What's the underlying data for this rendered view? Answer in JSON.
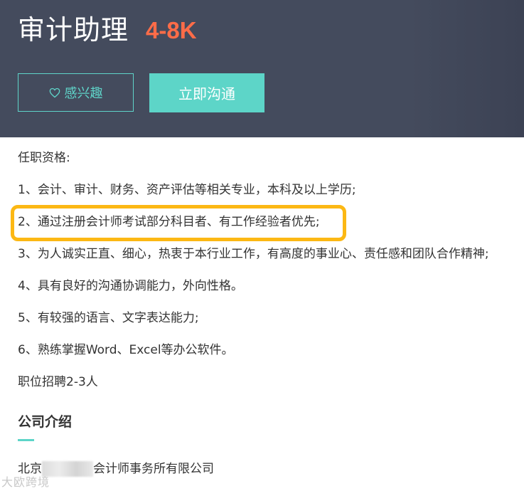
{
  "job": {
    "title": "审计助理",
    "salary": "4-8K"
  },
  "actions": {
    "interest_label": "感兴趣",
    "chat_label": "立即沟通"
  },
  "requirements": {
    "heading": "任职资格:",
    "items": [
      "1、会计、审计、财务、资产评估等相关专业，本科及以上学历;",
      "2、通过注册会计师考试部分科目者、有工作经验者优先;",
      "3、为人诚实正直、细心，热衷于本行业工作，有高度的事业心、责任感和团队合作精神;",
      "4、具有良好的沟通协调能力，外向性格。",
      "5、有较强的语言、文字表达能力;",
      "6、熟练掌握Word、Excel等办公软件。",
      "职位招聘2-3人"
    ]
  },
  "company": {
    "heading": "公司介绍",
    "name_prefix": "北京",
    "name_suffix": "会计师事务所有限公司"
  },
  "watermark": "大欧跨境",
  "colors": {
    "header_bg": "#444b5d",
    "accent": "#5dd5c8",
    "salary": "#fe6c48",
    "highlight": "#fcb814"
  },
  "icons": {
    "interest": "heart-outline-icon"
  }
}
